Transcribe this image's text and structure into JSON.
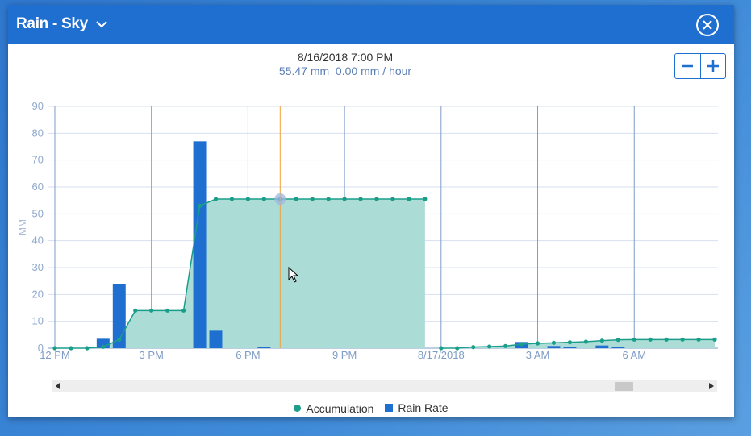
{
  "window": {
    "title": "Rain - Sky",
    "colors": {
      "titlebar": "#1f6fd1",
      "accumulation": "#1a9e8a",
      "accumulation_fill": "#acdcd6",
      "rain_rate": "#1f6fd1",
      "crosshair": "#f2a33a"
    }
  },
  "tooltip": {
    "datetime": "8/16/2018 7:00 PM",
    "values": "55.47 mm  0.00 mm / hour"
  },
  "zoom": {
    "out_icon": "minus-icon",
    "in_icon": "plus-icon"
  },
  "legend": {
    "accumulation": "Accumulation",
    "rain_rate": "Rain Rate"
  },
  "chart_data": {
    "type": "line",
    "ylabel": "MM",
    "ylim": [
      0,
      90
    ],
    "yticks": [
      0,
      10,
      20,
      30,
      40,
      50,
      60,
      70,
      80,
      90
    ],
    "xlim": [
      -0.2,
      20.6
    ],
    "xticks": [
      {
        "x": 0,
        "label": "12 PM"
      },
      {
        "x": 3,
        "label": "3 PM"
      },
      {
        "x": 6,
        "label": "6 PM"
      },
      {
        "x": 9,
        "label": "9 PM"
      },
      {
        "x": 12,
        "label": "8/17/2018"
      },
      {
        "x": 15,
        "label": "3 AM"
      },
      {
        "x": 18,
        "label": "6 AM"
      }
    ],
    "crosshair_x": 7,
    "series": [
      {
        "name": "Accumulation",
        "type": "area",
        "segments": [
          [
            {
              "x": 0,
              "y": 0
            },
            {
              "x": 0.5,
              "y": 0
            },
            {
              "x": 1,
              "y": 0
            },
            {
              "x": 1.5,
              "y": 0.5
            },
            {
              "x": 2,
              "y": 3.2
            },
            {
              "x": 2.5,
              "y": 14
            },
            {
              "x": 3,
              "y": 14
            },
            {
              "x": 3.5,
              "y": 14
            },
            {
              "x": 4,
              "y": 14
            },
            {
              "x": 4.5,
              "y": 53
            },
            {
              "x": 5,
              "y": 55.5
            },
            {
              "x": 5.5,
              "y": 55.5
            },
            {
              "x": 6,
              "y": 55.5
            },
            {
              "x": 6.5,
              "y": 55.5
            },
            {
              "x": 7,
              "y": 55.5
            },
            {
              "x": 7.5,
              "y": 55.5
            },
            {
              "x": 8,
              "y": 55.5
            },
            {
              "x": 8.5,
              "y": 55.5
            },
            {
              "x": 9,
              "y": 55.5
            },
            {
              "x": 9.5,
              "y": 55.5
            },
            {
              "x": 10,
              "y": 55.5
            },
            {
              "x": 10.5,
              "y": 55.5
            },
            {
              "x": 11,
              "y": 55.5
            },
            {
              "x": 11.5,
              "y": 55.5
            }
          ],
          [
            {
              "x": 12,
              "y": 0
            },
            {
              "x": 12.5,
              "y": 0
            },
            {
              "x": 13,
              "y": 0.4
            },
            {
              "x": 13.5,
              "y": 0.6
            },
            {
              "x": 14,
              "y": 0.8
            },
            {
              "x": 14.5,
              "y": 1.5
            },
            {
              "x": 15,
              "y": 1.8
            },
            {
              "x": 15.5,
              "y": 2.0
            },
            {
              "x": 16,
              "y": 2.2
            },
            {
              "x": 16.5,
              "y": 2.4
            },
            {
              "x": 17,
              "y": 2.8
            },
            {
              "x": 17.5,
              "y": 3.1
            },
            {
              "x": 18,
              "y": 3.2
            },
            {
              "x": 18.5,
              "y": 3.2
            },
            {
              "x": 19,
              "y": 3.2
            },
            {
              "x": 19.5,
              "y": 3.2
            },
            {
              "x": 20,
              "y": 3.2
            },
            {
              "x": 20.5,
              "y": 3.2
            }
          ]
        ]
      },
      {
        "name": "Rain Rate",
        "type": "bar",
        "bar_width": 0.4,
        "points": [
          {
            "x": 1.5,
            "y": 3.5
          },
          {
            "x": 2,
            "y": 24
          },
          {
            "x": 4.5,
            "y": 77
          },
          {
            "x": 5,
            "y": 6.5
          },
          {
            "x": 6.5,
            "y": 0.4
          },
          {
            "x": 14.5,
            "y": 2.3
          },
          {
            "x": 15.5,
            "y": 0.8
          },
          {
            "x": 16,
            "y": 0.3
          },
          {
            "x": 17,
            "y": 1.0
          },
          {
            "x": 17.5,
            "y": 0.6
          }
        ]
      }
    ]
  }
}
